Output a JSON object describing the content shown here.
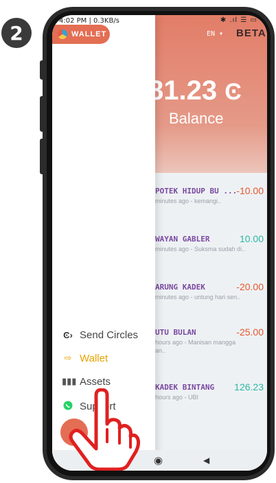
{
  "step_badge": "2",
  "status_bar": {
    "time": "4:02 PM | 0.3KB/s",
    "icons": "✱ .ıl ☰ ▭"
  },
  "header": {
    "language": "EN ▾",
    "beta": "BETA"
  },
  "drawer": {
    "logo_text": "WALLET",
    "items": [
      {
        "label": "Send Circles",
        "icon": "circles-send-icon"
      },
      {
        "label": "Wallet",
        "icon": "wallet-icon",
        "active": true
      },
      {
        "label": "Assets",
        "icon": "assets-chart-icon"
      },
      {
        "label": "Support",
        "icon": "whatsapp-icon"
      }
    ]
  },
  "balance": {
    "amount": "81.23",
    "label": "Balance"
  },
  "transactions": [
    {
      "name": "POTEK HIDUP BU ...",
      "amount": "-10.00",
      "sub": "minutes ago - kemangi..",
      "type": "neg"
    },
    {
      "name": "WAYAN GABLER",
      "amount": "10.00",
      "sub": "minutes ago - Suksma sudah di..",
      "type": "pos"
    },
    {
      "name": "ARUNG KADEK",
      "amount": "-20.00",
      "sub": "minutes ago - untung hari sen..",
      "type": "neg"
    },
    {
      "name": "UTU BULAN",
      "amount": "-25.00",
      "sub": "hours ago - Manisan mangga",
      "sub2": "an..",
      "type": "neg"
    },
    {
      "name": "KADEK BINTANG",
      "amount": "126.23",
      "sub": "hours ago - UBI",
      "type": "pos"
    }
  ],
  "colors": {
    "accent": "#e36e54",
    "positive": "#2bb7a1",
    "negative": "#e4572e",
    "active_menu": "#e8a300"
  }
}
